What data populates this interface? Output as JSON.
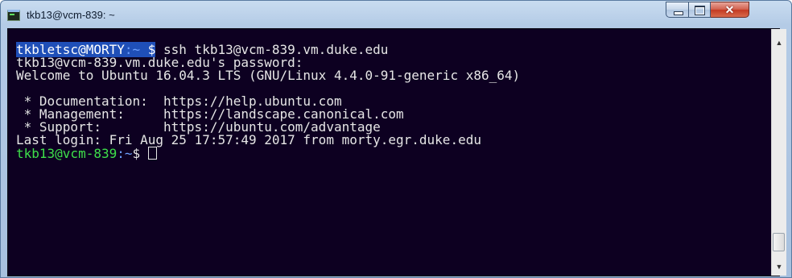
{
  "window": {
    "title": "tkb13@vcm-839: ~",
    "controls": {
      "minimize": "minimize-icon",
      "maximize": "maximize-icon",
      "close": "close-icon",
      "close_glyph": "✕"
    }
  },
  "terminal": {
    "line1": {
      "prompt_user": "tkbletsc@MORTY",
      "prompt_path": ":~",
      "prompt_symbol": " $",
      "command": " ssh tkb13@vcm-839.vm.duke.edu"
    },
    "line2": "tkb13@vcm-839.vm.duke.edu's password:",
    "line3": "Welcome to Ubuntu 16.04.3 LTS (GNU/Linux 4.4.0-91-generic x86_64)",
    "line4": "",
    "line5": " * Documentation:  https://help.ubuntu.com",
    "line6": " * Management:     https://landscape.canonical.com",
    "line7": " * Support:        https://ubuntu.com/advantage",
    "line8": "Last login: Fri Aug 25 17:57:49 2017 from morty.egr.duke.edu",
    "line9": {
      "prompt_user": "tkb13@vcm-839",
      "prompt_path": ":~",
      "prompt_symbol": "$ "
    }
  },
  "scrollbar": {
    "up_glyph": "▲",
    "down_glyph": "▼"
  },
  "colors": {
    "terminal_bg": "#0d0021",
    "terminal_fg": "#e6e6e6",
    "prompt_green": "#3ee04a",
    "prompt_blue": "#6ea0ff",
    "selection_bg": "#1f4fb8"
  }
}
